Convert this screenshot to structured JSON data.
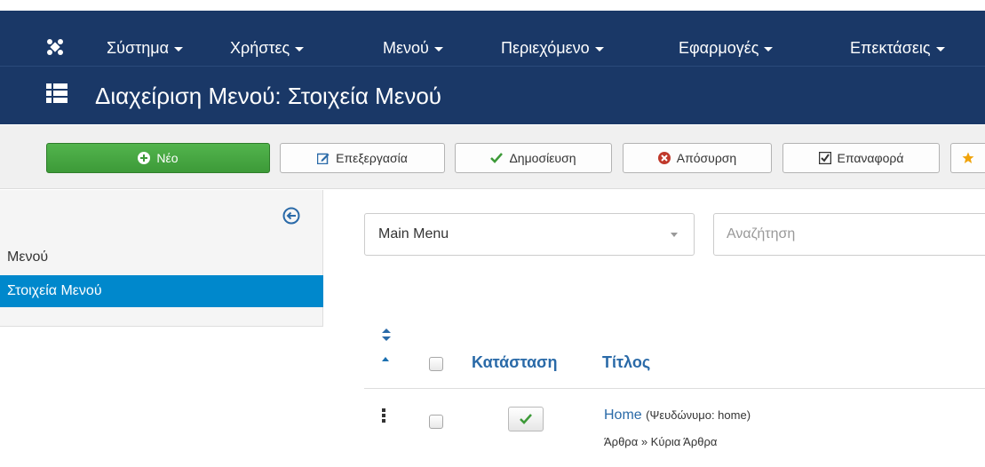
{
  "top_nav": {
    "logo_icon": "joomla-logo-icon",
    "items": [
      {
        "label": "Σύστημα"
      },
      {
        "label": "Χρήστες"
      },
      {
        "label": "Μενού"
      },
      {
        "label": "Περιεχόμενο"
      },
      {
        "label": "Εφαρμογές"
      },
      {
        "label": "Επεκτάσεις"
      }
    ]
  },
  "page": {
    "title_icon": "list-icon",
    "title": "Διαχείριση Μενού: Στοιχεία Μενού"
  },
  "toolbar": {
    "new_label": "Νέο",
    "edit_label": "Επεξεργασία",
    "publish_label": "Δημοσίευση",
    "unpublish_label": "Απόσυρση",
    "checkin_label": "Επαναφορά"
  },
  "sidebar": {
    "items": [
      {
        "label": "Μενού",
        "active": false
      },
      {
        "label": "Στοιχεία Μενού",
        "active": true
      }
    ]
  },
  "filters": {
    "menu_select_value": "Main Menu",
    "search_placeholder": "Αναζήτηση"
  },
  "table": {
    "headers": {
      "status": "Κατάσταση",
      "title": "Τίτλος"
    },
    "rows": [
      {
        "title": "Home",
        "alias": "(Ψευδώνυμο: home)",
        "path": "Άρθρα » Κύρια Άρθρα",
        "published": true
      }
    ]
  },
  "colors": {
    "navbar": "#1a3867",
    "new_button": "#46a546",
    "active_sidebar": "#0088cc",
    "link": "#2a6aa8"
  }
}
